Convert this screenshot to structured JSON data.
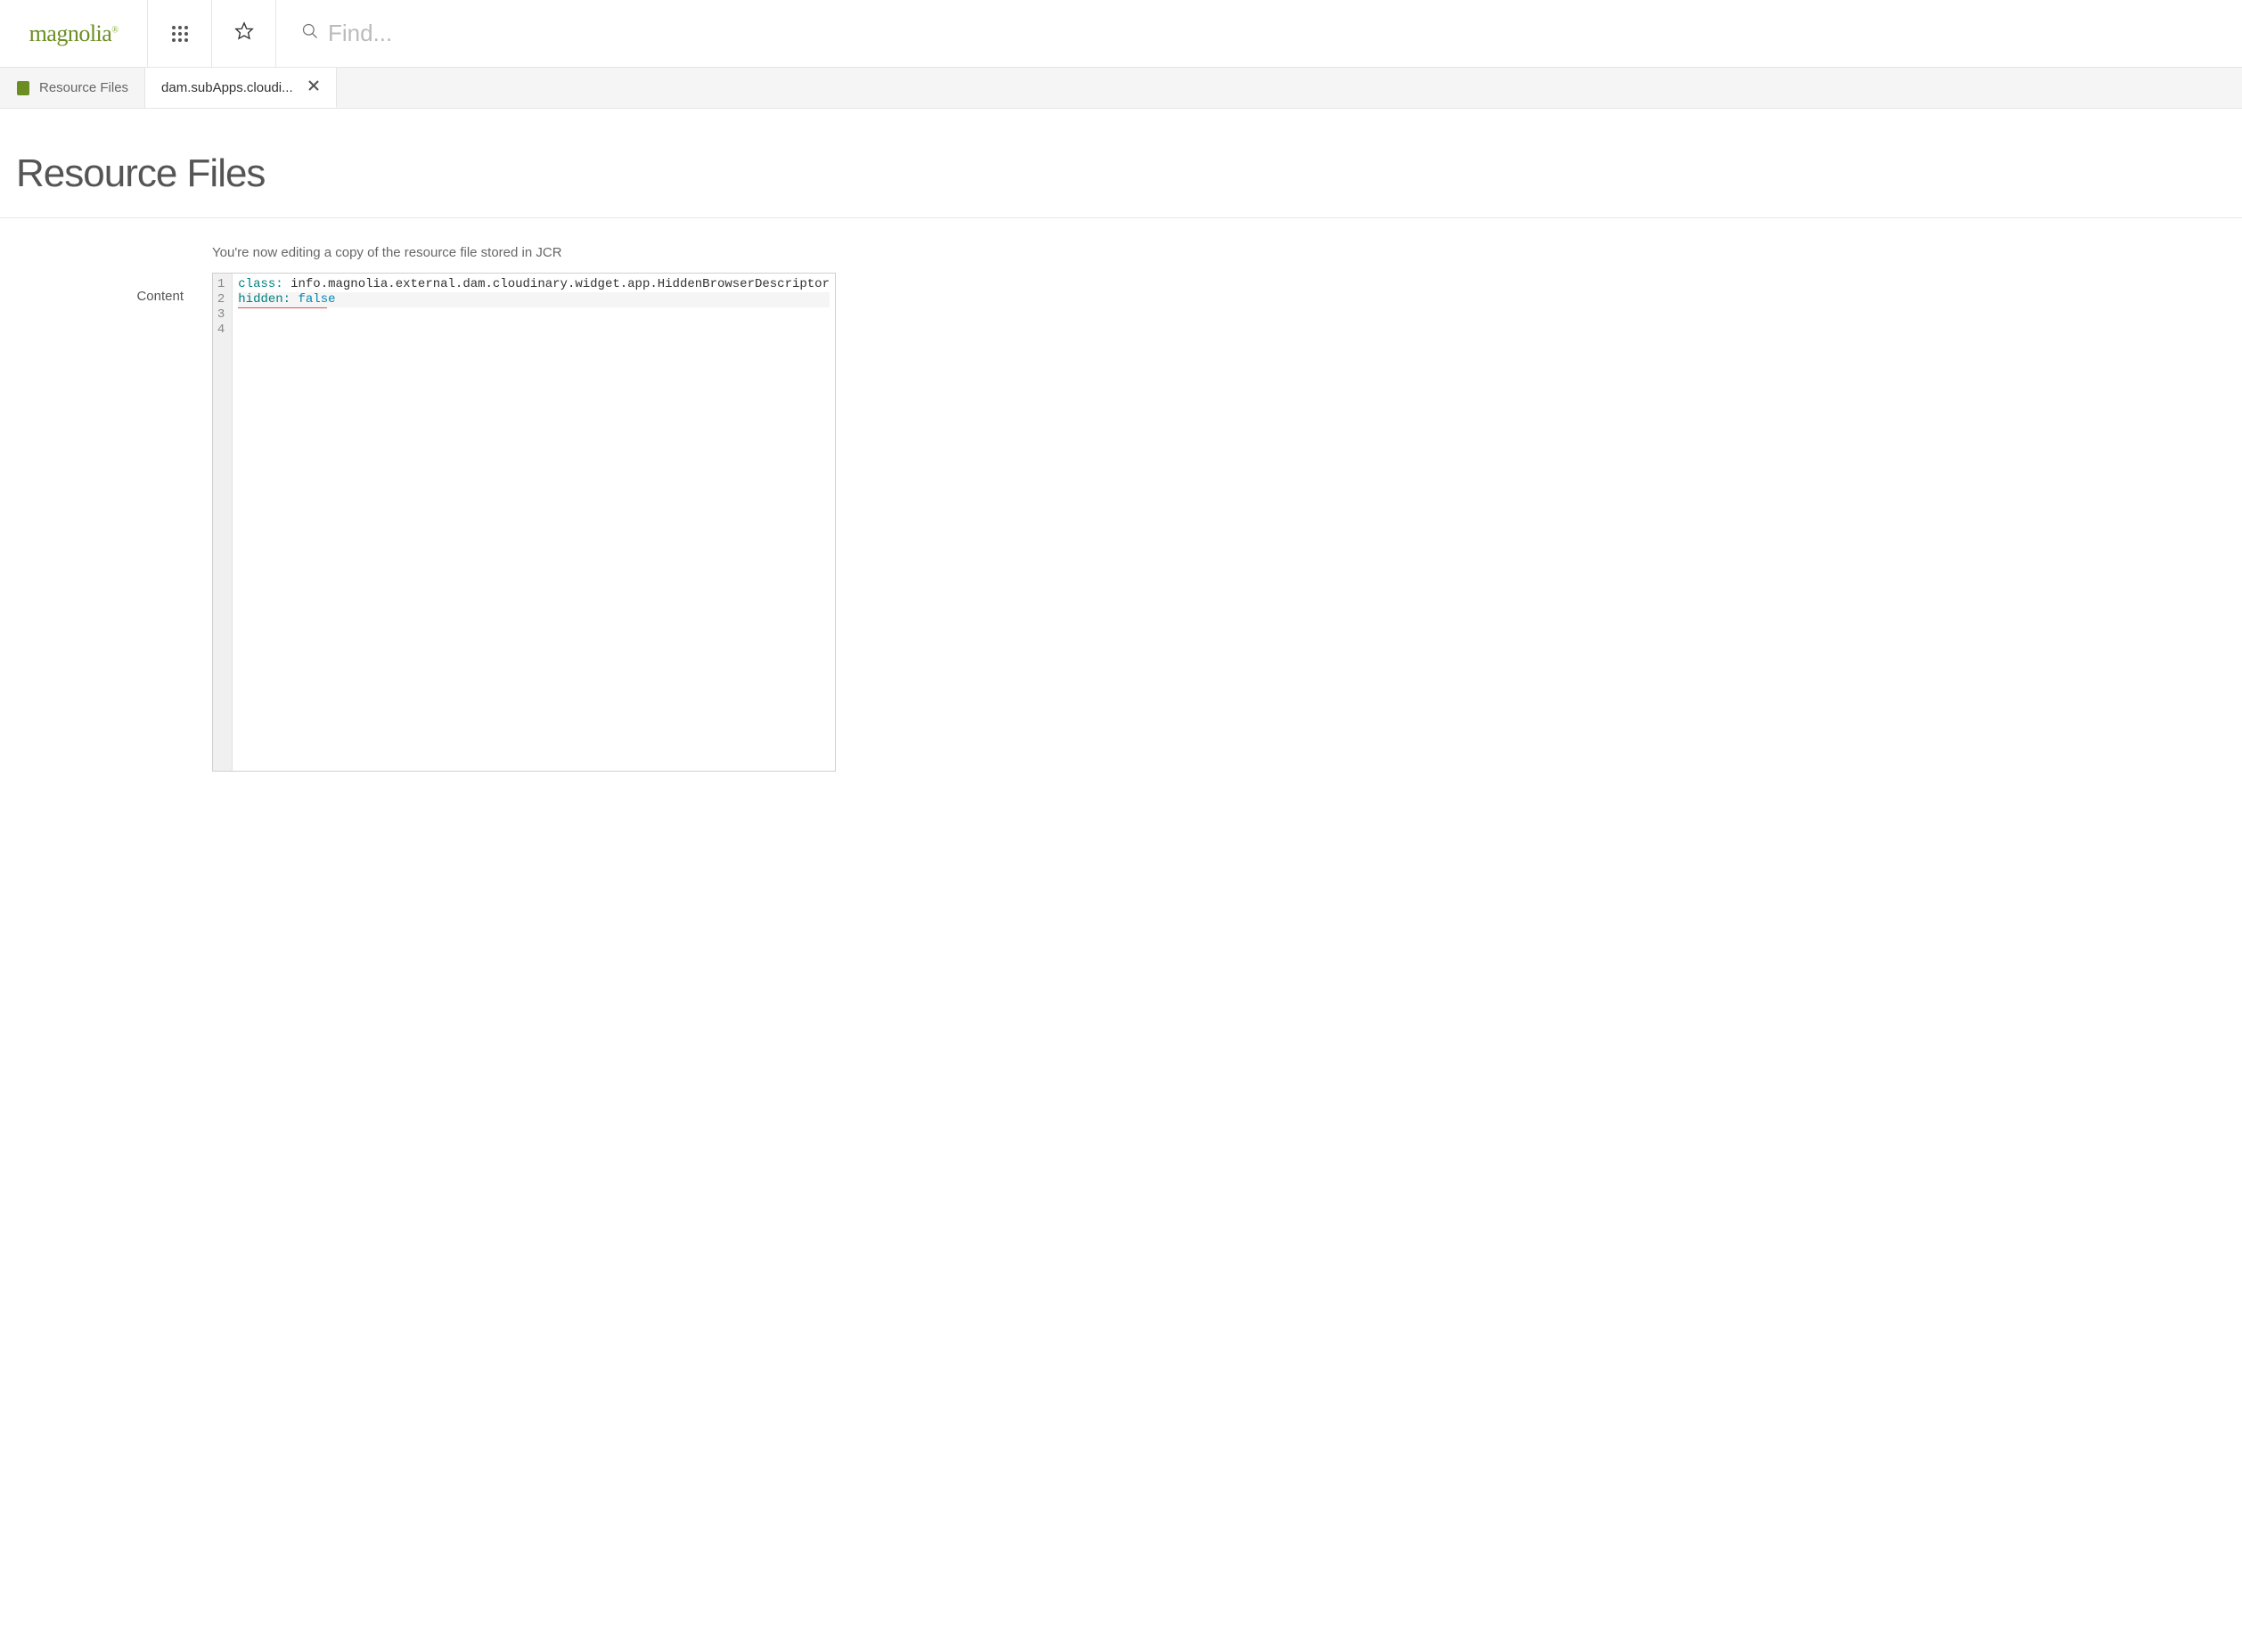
{
  "header": {
    "logo_text": "magnolia",
    "search_placeholder": "Find..."
  },
  "tabs": [
    {
      "label": "Resource Files",
      "active": false,
      "has_icon": true,
      "closable": false
    },
    {
      "label": "dam.subApps.cloudi...",
      "active": true,
      "has_icon": false,
      "closable": true
    }
  ],
  "page": {
    "title": "Resource Files",
    "info_message": "You're now editing a copy of the resource file stored in JCR",
    "field_label": "Content"
  },
  "editor": {
    "line_numbers": [
      "1",
      "2",
      "3",
      "4"
    ],
    "lines": [
      {
        "segments": [
          {
            "text": "class:",
            "class": "kw"
          },
          {
            "text": " info.magnolia.external.dam.cloudinary.widget.app.HiddenBrowserDescriptor",
            "class": "val"
          }
        ],
        "active": false,
        "underline_width": 0
      },
      {
        "segments": [
          {
            "text": "hidden:",
            "class": "kw"
          },
          {
            "text": " ",
            "class": "val"
          },
          {
            "text": "false",
            "class": "bool"
          }
        ],
        "active": true,
        "underline_width": 100
      },
      {
        "segments": [],
        "active": false,
        "underline_width": 0
      },
      {
        "segments": [],
        "active": false,
        "underline_width": 0
      }
    ]
  }
}
